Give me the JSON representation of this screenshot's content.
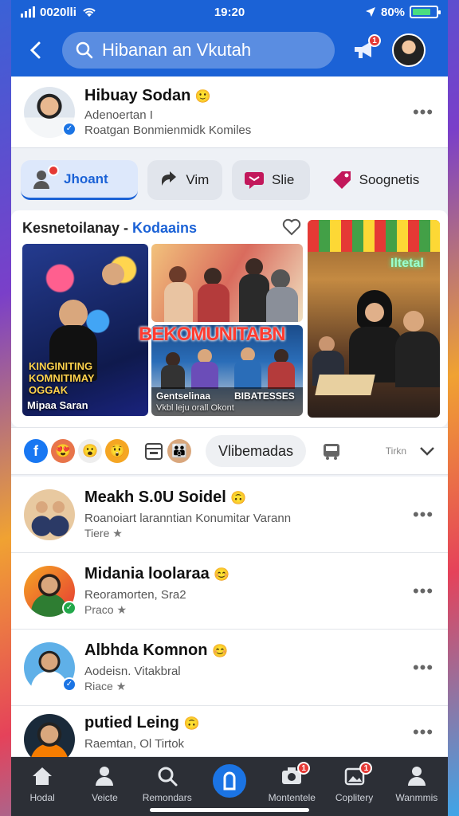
{
  "status_bar": {
    "carrier": "0020lli",
    "time": "19:20",
    "battery": "80%"
  },
  "header": {
    "search_text": "Hibanan an Vkutah",
    "notification_count": "1",
    "icons": [
      "back-chevron-icon",
      "search-icon",
      "megaphone-icon"
    ]
  },
  "profile": {
    "name": "Hibuay Sodan",
    "line1": "Adenoertan I",
    "line2": "Roatgan Bonmienmidk Komiles"
  },
  "tabs": [
    {
      "label": "Jhoant",
      "icon": "groups-icon",
      "active": true
    },
    {
      "label": "Vim",
      "icon": "share-icon",
      "active": false
    },
    {
      "label": "Slie",
      "icon": "message-icon",
      "active": false
    },
    {
      "label": "Soognetis",
      "icon": "tag-icon",
      "active": false
    }
  ],
  "feature": {
    "title_prefix": "Kesnetoilanay - ",
    "title_accent": "Kodaains",
    "img1_overlay": "KINGINITING\nKOMNITIMAY\nOGGAK",
    "img1_caption": "Mipaa Saran",
    "img2_overlay": "BEKOMUNITABN",
    "img3_caption_1": "Gentselinaa",
    "img3_caption_2": "BIBATESSES",
    "img3_sub": "Vkbl leju orall Okont",
    "img4_sign": "Iltetal"
  },
  "reactions": {
    "pill_label": "Vlibemadas",
    "small_label": "Tirkn"
  },
  "list": [
    {
      "name": "Meakh S.0U Soidel",
      "sub": "Roanoiart laranntian Konumitar Varann",
      "meta": "Tiere",
      "verified": ""
    },
    {
      "name": "Midania loolaraa",
      "sub": "Reoramorten, Sra2",
      "meta": "Praco",
      "verified": "green"
    },
    {
      "name": "Albhda Komnon",
      "sub": "Aodeisn. Vitakbral",
      "meta": "Riace",
      "verified": "blue"
    },
    {
      "name": "putied Leing",
      "sub": "Raemtan, Ol Tirtok",
      "meta": "",
      "verified": ""
    }
  ],
  "bottom_nav": [
    {
      "label": "Hodal",
      "icon": "home-icon"
    },
    {
      "label": "Veicte",
      "icon": "people-icon"
    },
    {
      "label": "Remondars",
      "icon": "search-icon"
    },
    {
      "label": "",
      "icon": "create-icon"
    },
    {
      "label": "Montentele",
      "icon": "camera-icon",
      "badge": "1"
    },
    {
      "label": "Coplitery",
      "icon": "gallery-icon",
      "badge": "1"
    },
    {
      "label": "Wanmmis",
      "icon": "profile-icon"
    }
  ],
  "colors": {
    "brand": "#1b62d6",
    "accent": "#1b74e4",
    "badge": "#e53935"
  }
}
